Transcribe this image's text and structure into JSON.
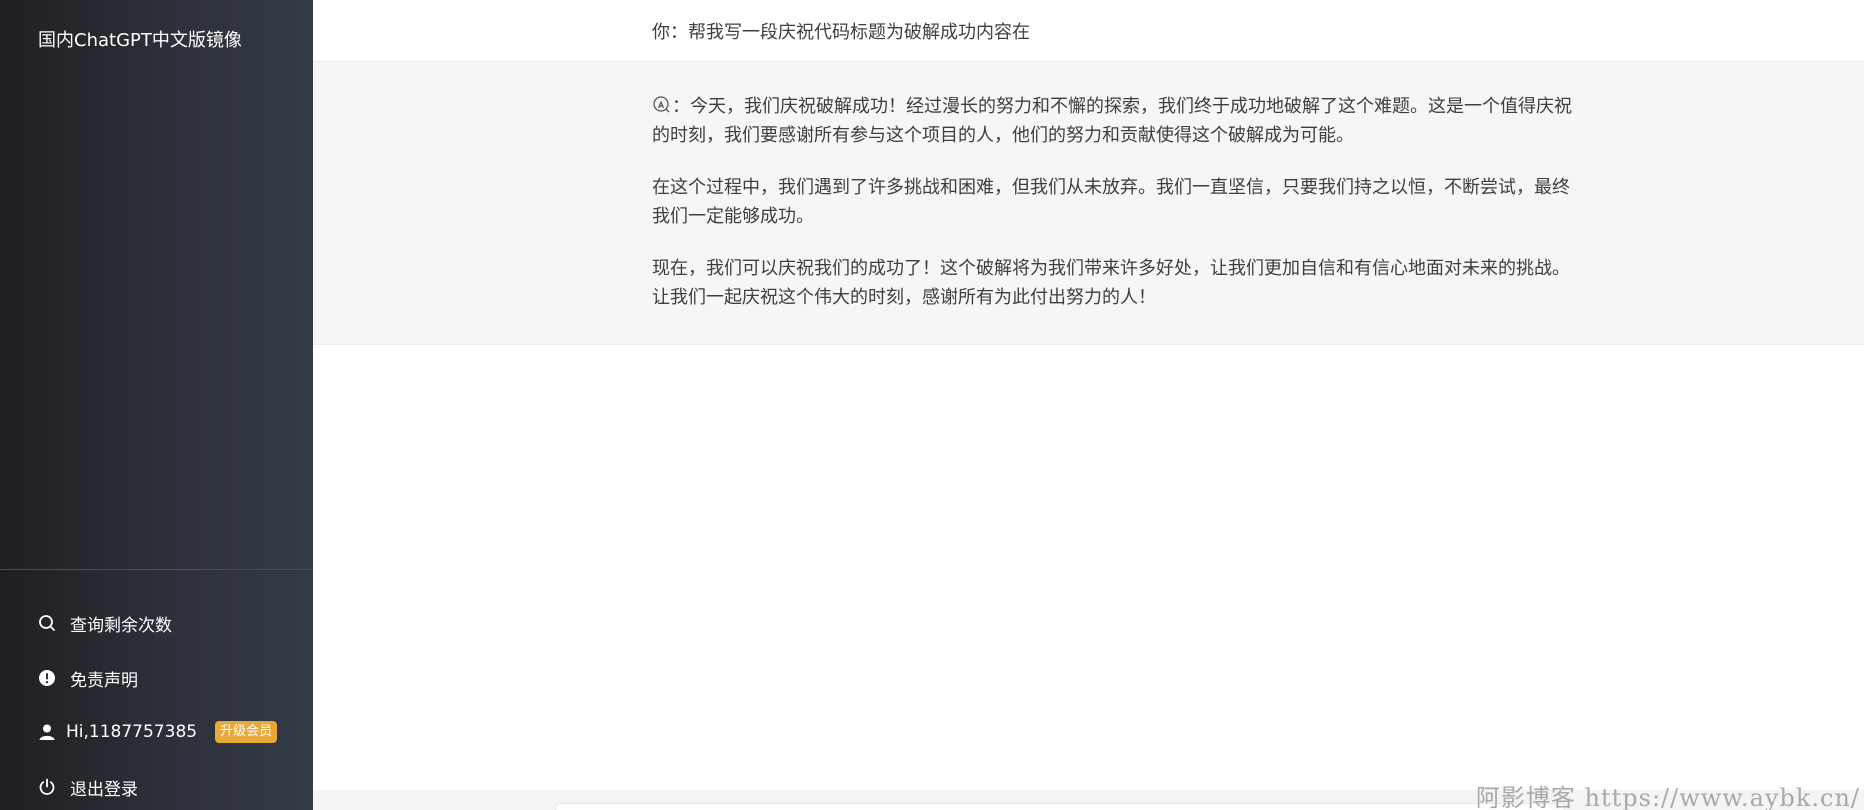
{
  "sidebar": {
    "title": "国内ChatGPT中文版镜像",
    "items": [
      {
        "label": "查询剩余次数",
        "icon": "search-icon"
      },
      {
        "label": "免责声明",
        "icon": "alert-circle-icon"
      },
      {
        "label": "Hi,1187757385",
        "icon": "user-icon",
        "badge": "升级会员"
      },
      {
        "label": "退出登录",
        "icon": "power-icon"
      }
    ]
  },
  "chat": {
    "user_message": "你：帮我写一段庆祝代码标题为破解成功内容在",
    "ai_prefix": "：",
    "ai_paragraphs": [
      "今天，我们庆祝破解成功！经过漫长的努力和不懈的探索，我们终于成功地破解了这个难题。这是一个值得庆祝的时刻，我们要感谢所有参与这个项目的人，他们的努力和贡献使得这个破解成为可能。",
      "在这个过程中，我们遇到了许多挑战和困难，但我们从未放弃。我们一直坚信，只要我们持之以恒，不断尝试，最终我们一定能够成功。",
      "现在，我们可以庆祝我们的成功了！这个破解将为我们带来许多好处，让我们更加自信和有信心地面对未来的挑战。让我们一起庆祝这个伟大的时刻，感谢所有为此付出努力的人！"
    ]
  },
  "watermark": "阿影博客 https://www.aybk.cn/",
  "colors": {
    "badge": "#e9a93a",
    "sidebar_bg": "#2d323c",
    "ai_bg": "#f6f6f6"
  }
}
